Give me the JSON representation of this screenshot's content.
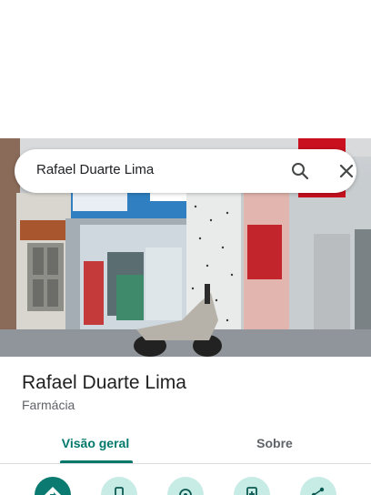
{
  "search": {
    "query": "Rafael Duarte Lima"
  },
  "place": {
    "name": "Rafael Duarte Lima",
    "category": "Farmácia"
  },
  "tabs": [
    {
      "label": "Visão geral",
      "selected": true
    },
    {
      "label": "Sobre",
      "selected": false
    }
  ],
  "actions": [
    {
      "icon": "directions-icon"
    },
    {
      "icon": "phone-icon"
    },
    {
      "icon": "location-icon"
    },
    {
      "icon": "add-to-phone-icon"
    },
    {
      "icon": "share-icon"
    }
  ],
  "colors": {
    "accent": "#00796b",
    "primary_action": "#0b7a70",
    "secondary_action": "#c7ebe5"
  }
}
